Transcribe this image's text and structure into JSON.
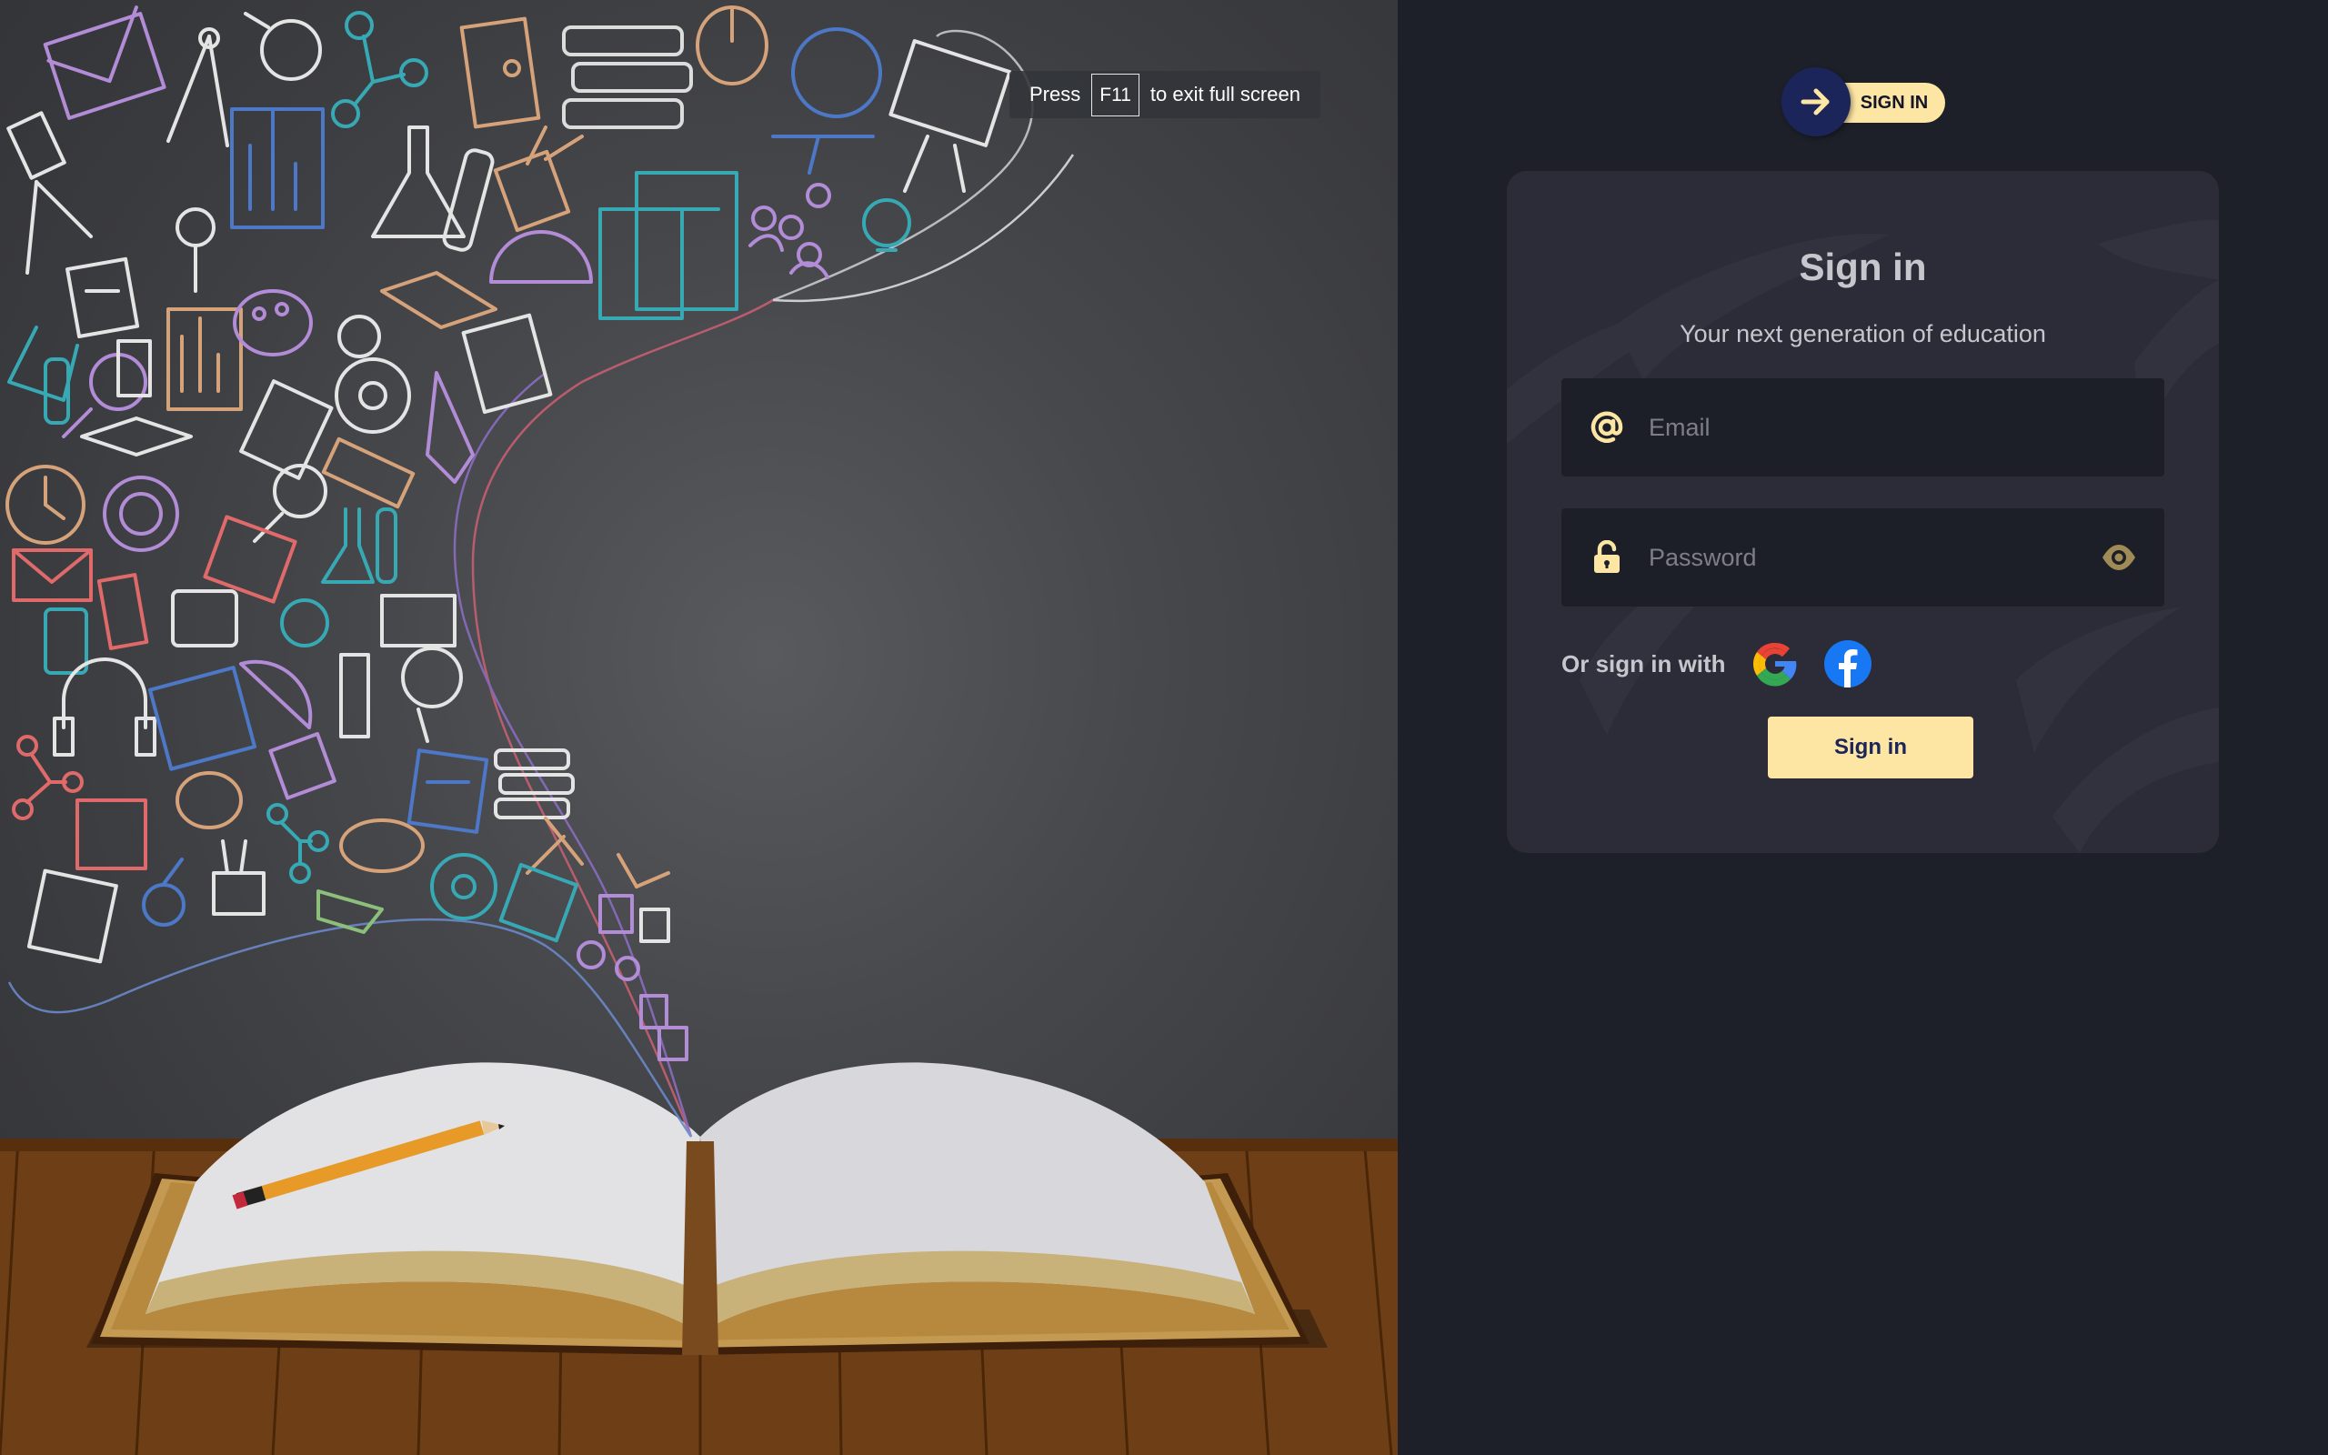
{
  "fullscreen_hint": {
    "prefix": "Press",
    "key": "F11",
    "suffix": "to exit full screen"
  },
  "mode_toggle": {
    "label": "SIGN IN",
    "icon": "arrow-right-icon"
  },
  "signin_card": {
    "title": "Sign in",
    "subtitle": "Your next generation of education",
    "email": {
      "placeholder": "Email",
      "icon": "at-icon"
    },
    "password": {
      "placeholder": "Password",
      "icon": "unlock-icon",
      "toggle_icon": "eye-icon"
    },
    "social_label": "Or sign in with",
    "social_providers": [
      "google",
      "facebook"
    ],
    "submit_label": "Sign in"
  },
  "colors": {
    "accent": "#fde5a3",
    "navy": "#1b2559",
    "panel_bg": "#1e2029",
    "card_bg": "#2b2c37",
    "field_bg": "#1d1f28"
  }
}
